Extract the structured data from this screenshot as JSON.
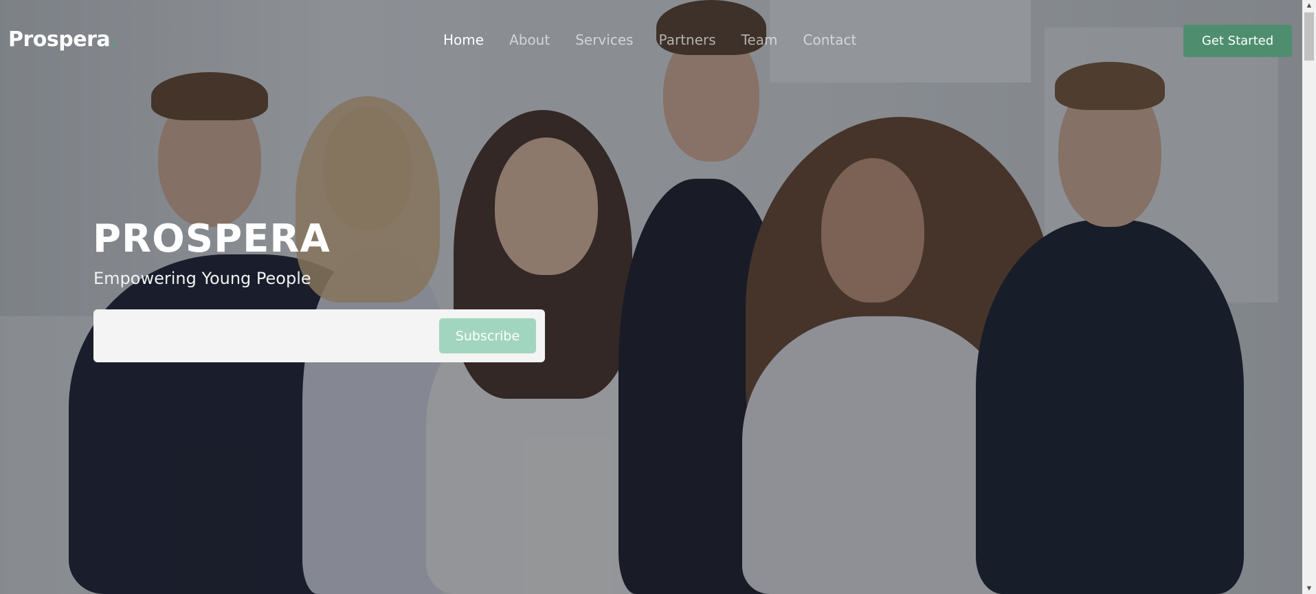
{
  "brand": {
    "name": "Prospera",
    "dot": ".",
    "accent": "#4e8e6e"
  },
  "nav": {
    "items": [
      {
        "label": "Home",
        "active": true
      },
      {
        "label": "About",
        "active": false
      },
      {
        "label": "Services",
        "active": false
      },
      {
        "label": "Partners",
        "active": false
      },
      {
        "label": "Team",
        "active": false
      },
      {
        "label": "Contact",
        "active": false
      }
    ],
    "cta_label": "Get Started"
  },
  "hero": {
    "title": "PROSPERA",
    "subtitle": "Empowering Young People",
    "email_placeholder": "",
    "subscribe_label": "Subscribe"
  },
  "scrollbar": {
    "up_icon": "triangle-up",
    "down_icon": "triangle-down"
  }
}
